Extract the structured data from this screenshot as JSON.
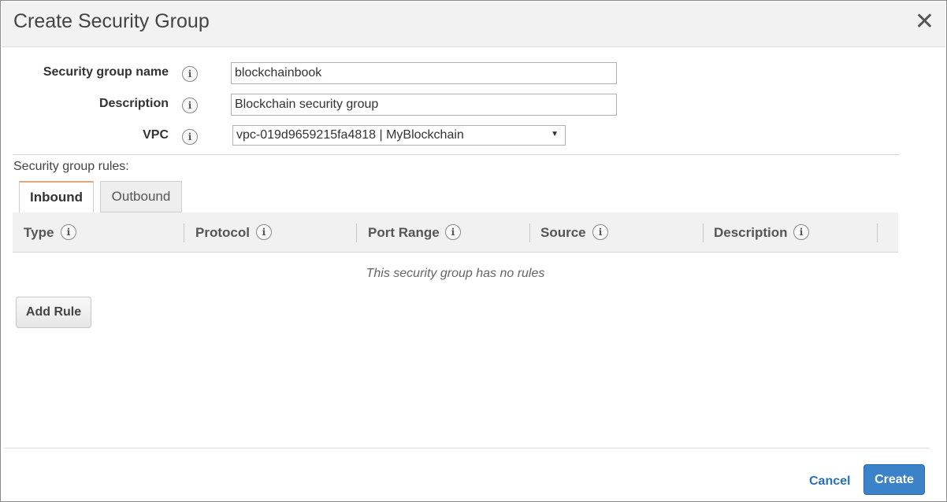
{
  "modal": {
    "title": "Create Security Group",
    "close_glyph": "✕"
  },
  "form": {
    "name_label": "Security group name",
    "name_value": "blockchainbook",
    "description_label": "Description",
    "description_value": "Blockchain security group",
    "vpc_label": "VPC",
    "vpc_selected": "vpc-019d9659215fa4818 | MyBlockchain",
    "info_glyph": "i"
  },
  "rules": {
    "caption": "Security group rules:",
    "tabs": [
      {
        "label": "Inbound",
        "active": true
      },
      {
        "label": "Outbound",
        "active": false
      }
    ],
    "columns": [
      "Type",
      "Protocol",
      "Port Range",
      "Source",
      "Description"
    ],
    "empty_message": "This security group has no rules",
    "add_rule_label": "Add Rule"
  },
  "footer": {
    "cancel_label": "Cancel",
    "create_label": "Create"
  },
  "colors": {
    "primary_button": "#3b82c9",
    "link": "#2a71b8",
    "active_tab_accent": "#e0a878"
  },
  "icons": {
    "info": "info-icon",
    "close": "close-icon",
    "dropdown": "caret-down-icon"
  }
}
